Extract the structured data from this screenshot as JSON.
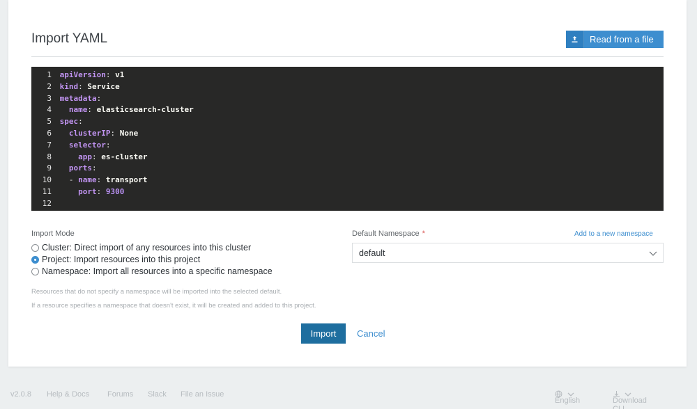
{
  "header": {
    "title": "Import YAML",
    "read_file_label": "Read from a file"
  },
  "editor": {
    "lines": [
      {
        "n": "1",
        "indent": "",
        "key": "apiVersion",
        "value": "v1"
      },
      {
        "n": "2",
        "indent": "",
        "key": "kind",
        "value": "Service"
      },
      {
        "n": "3",
        "indent": "",
        "key": "metadata",
        "value": ""
      },
      {
        "n": "4",
        "indent": "  ",
        "key": "name",
        "value": "elasticsearch-cluster"
      },
      {
        "n": "5",
        "indent": "",
        "key": "spec",
        "value": ""
      },
      {
        "n": "6",
        "indent": "  ",
        "key": "clusterIP",
        "value": "None"
      },
      {
        "n": "7",
        "indent": "  ",
        "key": "selector",
        "value": ""
      },
      {
        "n": "8",
        "indent": "    ",
        "key": "app",
        "value": "es-cluster"
      },
      {
        "n": "9",
        "indent": "  ",
        "key": "ports",
        "value": ""
      },
      {
        "n": "10",
        "indent": "  - ",
        "key": "name",
        "value": "transport"
      },
      {
        "n": "11",
        "indent": "    ",
        "key": "port",
        "value": "9300",
        "numeric": true
      },
      {
        "n": "12",
        "indent": "",
        "key": "",
        "value": ""
      }
    ]
  },
  "import_mode": {
    "label": "Import Mode",
    "options": [
      {
        "label": "Cluster: Direct import of any resources into this cluster",
        "checked": false
      },
      {
        "label": "Project: Import resources into this project",
        "checked": true
      },
      {
        "label": "Namespace: Import all resources into a specific namespace",
        "checked": false
      }
    ],
    "help": [
      "Resources that do not specify a namespace will be imported into the selected default.",
      "If a resource specifies a namespace that doesn't exist, it will be created and added to this project."
    ]
  },
  "namespace": {
    "label": "Default Namespace",
    "required_mark": "*",
    "add_link": "Add to a new namespace",
    "selected": "default"
  },
  "actions": {
    "import_label": "Import",
    "cancel_label": "Cancel"
  },
  "footer": {
    "version": "v2.0.8",
    "help": "Help & Docs",
    "forums": "Forums",
    "slack": "Slack",
    "issue": "File an Issue",
    "language": "English",
    "download": "Download CLI"
  },
  "colors": {
    "accent": "#3d8ecf",
    "primary_button": "#1e6e9f",
    "editor_bg": "#282827",
    "required": "#d9534f"
  }
}
